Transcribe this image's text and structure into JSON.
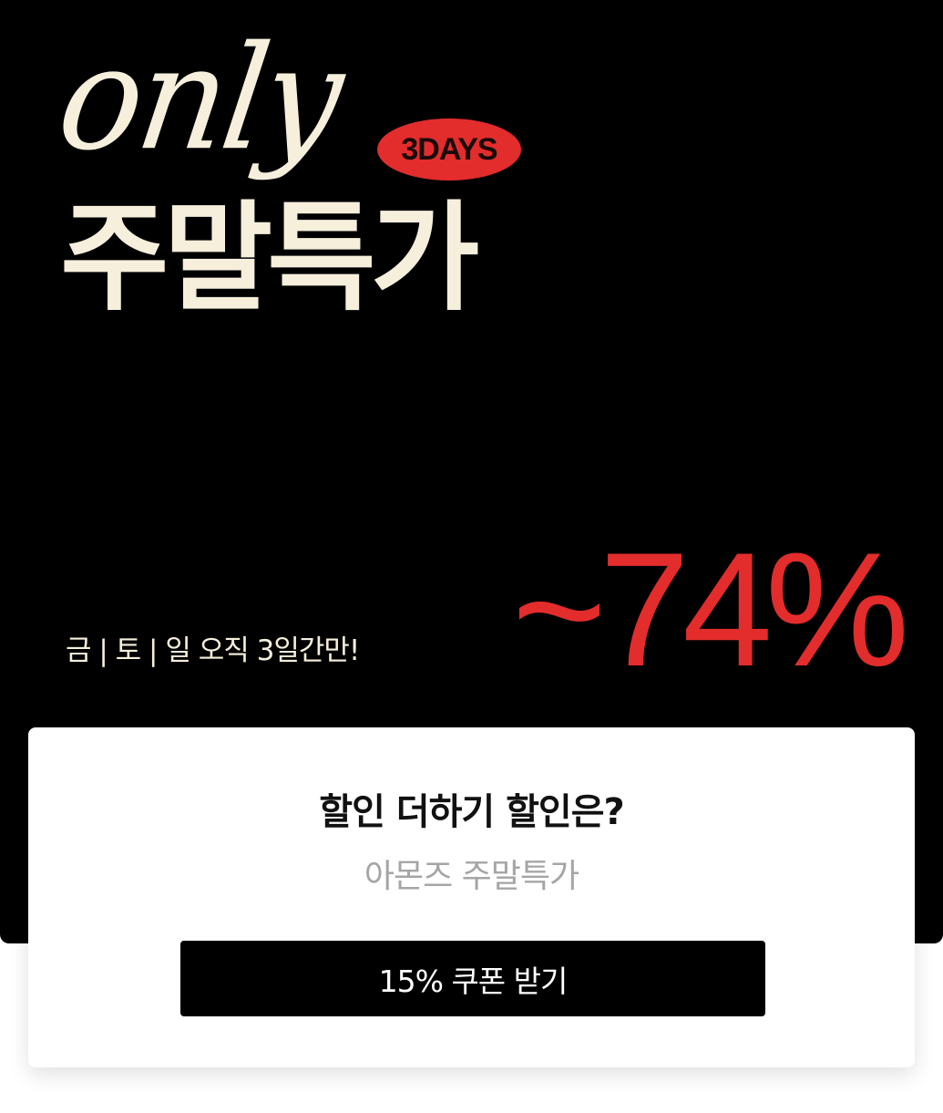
{
  "banner": {
    "script_word": "only",
    "badge": "3DAYS",
    "headline": "주말특가",
    "subline": "금 | 토 | 일 오직 3일간만!",
    "discount": "~74%"
  },
  "card": {
    "title": "할인 더하기 할인은?",
    "subtitle": "아몬즈 주말특가",
    "button_label": "15% 쿠폰 받기"
  },
  "colors": {
    "background": "#000000",
    "cream": "#f6efdc",
    "accent_red": "#e32c2c",
    "subtitle_gray": "#a5a5a5"
  }
}
